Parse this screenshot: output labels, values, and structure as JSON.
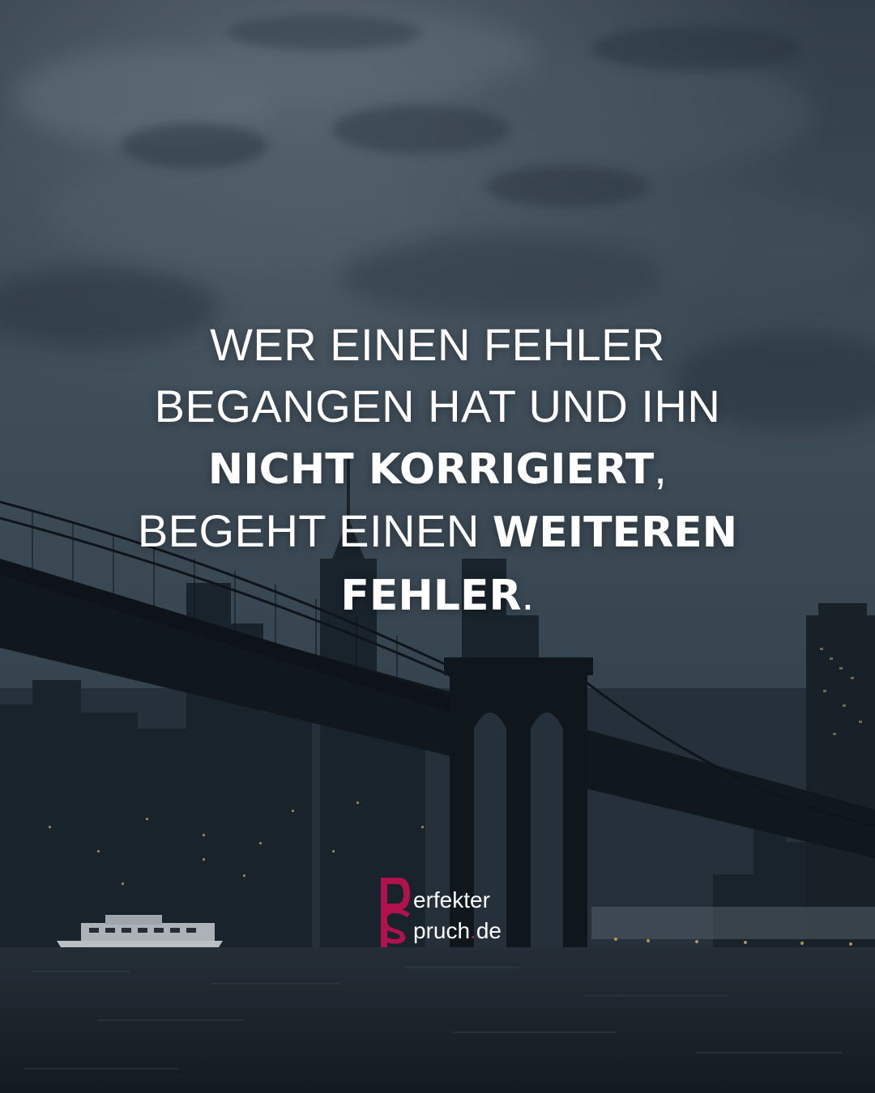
{
  "quote": {
    "line1": "WER EINEN FEHLER",
    "line2": "BEGANGEN HAT UND IHN",
    "line3_bold": "NICHT KORRIGIERT",
    "line3_tail": ",",
    "line4_light": "BEGEHT EINEN ",
    "line4_bold": "WEITEREN",
    "line5_bold": "FEHLER",
    "line5_tail": "."
  },
  "logo": {
    "line1": "erfekter",
    "line2_a": "pruch",
    "line2_dot": ".",
    "line2_b": "de",
    "mark_letters": "PS",
    "brand_color": "#b0124e"
  },
  "colors": {
    "sky_top": "#2f3c45",
    "sky_mid": "#4b5b66",
    "water": "#1c262d",
    "text": "#ffffff"
  }
}
